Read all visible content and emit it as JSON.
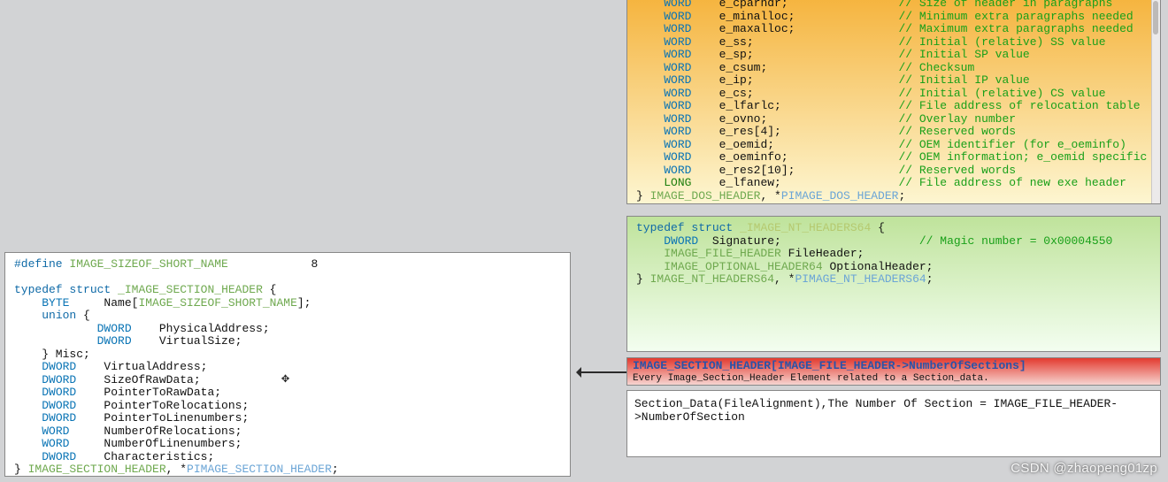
{
  "left": {
    "define_kw": "#define",
    "define_name": "IMAGE_SIZEOF_SHORT_NAME",
    "define_val": "8",
    "typedef": "typedef",
    "struct": "struct",
    "struct_name": "_IMAGE_SECTION_HEADER",
    "brace": "{",
    "members": [
      {
        "type": "BYTE",
        "name": "Name[",
        "ref": "IMAGE_SIZEOF_SHORT_NAME",
        "tail": "];"
      },
      {
        "union": "union {"
      },
      {
        "indent": 3,
        "type": "DWORD",
        "name": "PhysicalAddress;"
      },
      {
        "indent": 3,
        "type": "DWORD",
        "name": "VirtualSize;"
      },
      {
        "close": "} Misc;"
      },
      {
        "type": "DWORD",
        "name": "VirtualAddress;"
      },
      {
        "type": "DWORD",
        "name": "SizeOfRawData;"
      },
      {
        "type": "DWORD",
        "name": "PointerToRawData;"
      },
      {
        "type": "DWORD",
        "name": "PointerToRelocations;"
      },
      {
        "type": "DWORD",
        "name": "PointerToLinenumbers;"
      },
      {
        "type": "WORD",
        "name": "NumberOfRelocations;"
      },
      {
        "type": "WORD",
        "name": "NumberOfLinenumbers;"
      },
      {
        "type": "DWORD",
        "name": "Characteristics;"
      }
    ],
    "close_brace": "}",
    "end_name": "IMAGE_SECTION_HEADER",
    "end_sep": ", *",
    "end_ptr": "PIMAGE_SECTION_HEADER",
    "end_semi": ";"
  },
  "dos": {
    "fields": [
      {
        "t": "WORD",
        "n": "e_cparhdr;",
        "c": "// Size of header in paragraphs"
      },
      {
        "t": "WORD",
        "n": "e_minalloc;",
        "c": "// Minimum extra paragraphs needed"
      },
      {
        "t": "WORD",
        "n": "e_maxalloc;",
        "c": "// Maximum extra paragraphs needed"
      },
      {
        "t": "WORD",
        "n": "e_ss;",
        "c": "// Initial (relative) SS value"
      },
      {
        "t": "WORD",
        "n": "e_sp;",
        "c": "// Initial SP value"
      },
      {
        "t": "WORD",
        "n": "e_csum;",
        "c": "// Checksum"
      },
      {
        "t": "WORD",
        "n": "e_ip;",
        "c": "// Initial IP value"
      },
      {
        "t": "WORD",
        "n": "e_cs;",
        "c": "// Initial (relative) CS value"
      },
      {
        "t": "WORD",
        "n": "e_lfarlc;",
        "c": "// File address of relocation table"
      },
      {
        "t": "WORD",
        "n": "e_ovno;",
        "c": "// Overlay number"
      },
      {
        "t": "WORD",
        "n": "e_res[4];",
        "c": "// Reserved words"
      },
      {
        "t": "WORD",
        "n": "e_oemid;",
        "c": "// OEM identifier (for e_oeminfo)"
      },
      {
        "t": "WORD",
        "n": "e_oeminfo;",
        "c": "// OEM information; e_oemid specific"
      },
      {
        "t": "WORD",
        "n": "e_res2[10];",
        "c": "// Reserved words"
      },
      {
        "t": "LONG",
        "n": "e_lfanew;",
        "c": "// File address of new exe header"
      }
    ],
    "close_brace": "}",
    "end_name": "IMAGE_DOS_HEADER",
    "end_sep": ", *",
    "end_ptr": "PIMAGE_DOS_HEADER",
    "end_semi": ";"
  },
  "nt": {
    "typedef": "typedef",
    "struct": "struct",
    "name": "_IMAGE_NT_HEADERS64",
    "brace": "{",
    "sig_t": "DWORD",
    "sig_n": "Signature;",
    "sig_c": "// Magic number = 0x00004550",
    "fh_t": "IMAGE_FILE_HEADER",
    "fh_n": "FileHeader;",
    "oh_t": "IMAGE_OPTIONAL_HEADER64",
    "oh_n": "OptionalHeader;",
    "close_brace": "}",
    "end_name": "IMAGE_NT_HEADERS64",
    "end_sep": ", *",
    "end_ptr": "PIMAGE_NT_HEADERS64",
    "end_semi": ";"
  },
  "red": {
    "hdr": "IMAGE_SECTION_HEADER[IMAGE_FILE_HEADER->NumberOfSections]",
    "sub": "Every Image_Section_Header Element related to a Section_data."
  },
  "sect": {
    "text": "Section_Data(FileAlignment),The Number Of Section = IMAGE_FILE_HEADER->NumberOfSection"
  },
  "watermark": "CSDN @zhaopeng01zp"
}
